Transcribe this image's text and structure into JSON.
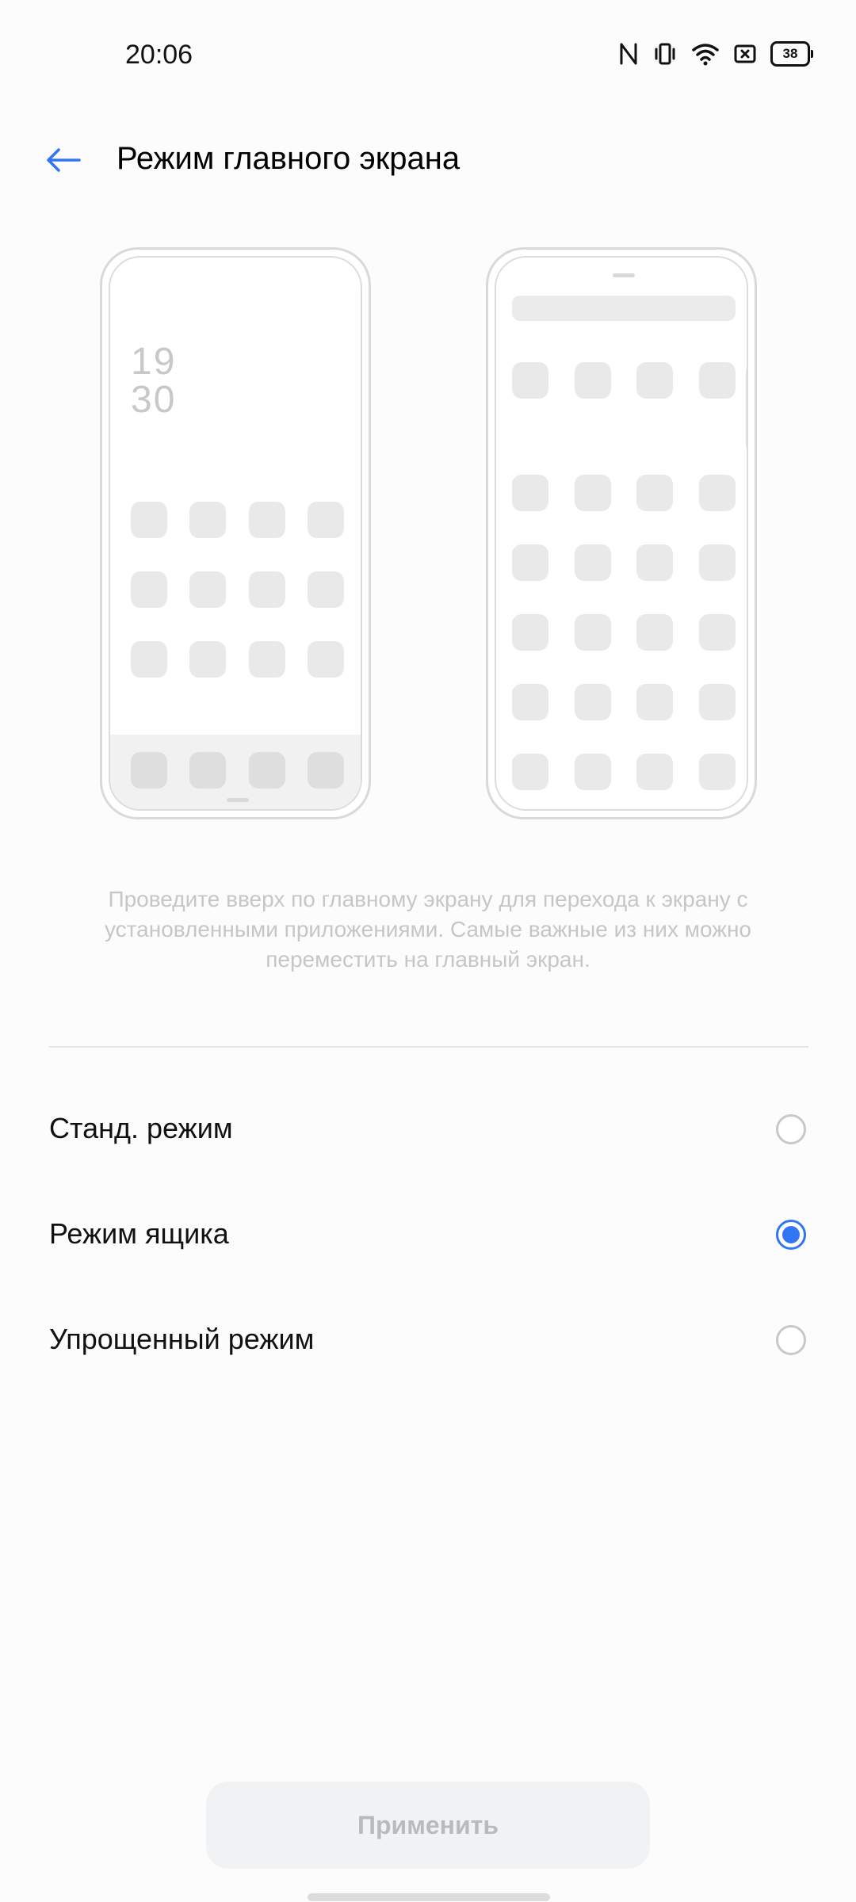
{
  "status_bar": {
    "time": "20:06",
    "battery": "38",
    "icons": [
      "nfc-icon",
      "vibrate-icon",
      "wifi-icon",
      "sim-icon",
      "battery-icon"
    ]
  },
  "header": {
    "title": "Режим главного экрана",
    "back_icon": "arrow-left-icon"
  },
  "preview": {
    "clock_hour": "19",
    "clock_minute": "30"
  },
  "description": "Проведите вверх по главному экрану для перехода к экрану с установленными приложениями. Самые важные из них можно переместить на главный экран.",
  "options": [
    {
      "label": "Станд. режим",
      "selected": false
    },
    {
      "label": "Режим ящика",
      "selected": true
    },
    {
      "label": "Упрощенный режим",
      "selected": false
    }
  ],
  "apply_button": {
    "label": "Применить"
  },
  "colors": {
    "accent": "#3175f5",
    "text_muted": "#c6c6c6",
    "divider": "#e6e6e6"
  }
}
